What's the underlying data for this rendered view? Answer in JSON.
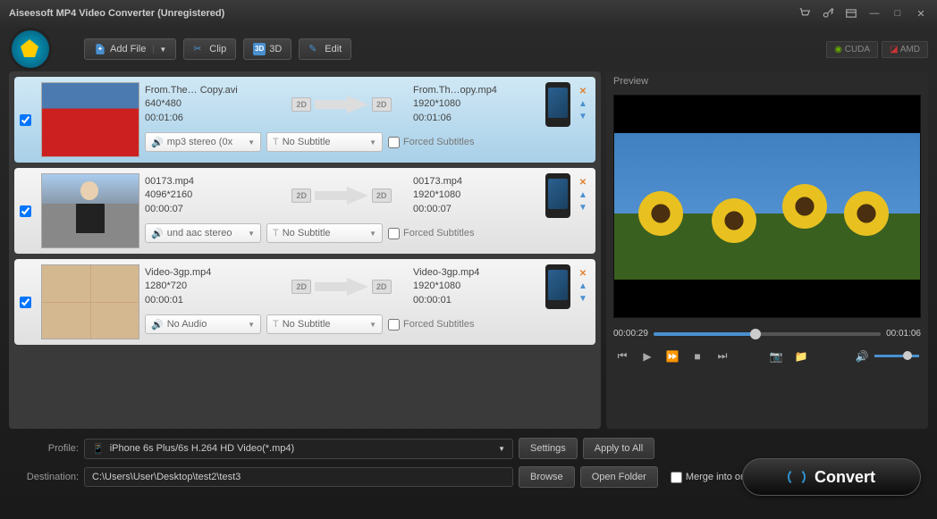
{
  "window": {
    "title": "Aiseesoft MP4 Video Converter (Unregistered)"
  },
  "toolbar": {
    "add_file": "Add File",
    "clip": "Clip",
    "three_d": "3D",
    "edit": "Edit",
    "cuda": "CUDA",
    "amd": "AMD"
  },
  "files": [
    {
      "selected": true,
      "src_name": "From.The… Copy.avi",
      "src_res": "640*480",
      "src_dur": "00:01:06",
      "dst_name": "From.Th…opy.mp4",
      "dst_res": "1920*1080",
      "dst_dur": "00:01:06",
      "audio": "mp3 stereo (0x",
      "subtitle": "No Subtitle",
      "forced": "Forced Subtitles"
    },
    {
      "selected": false,
      "src_name": "00173.mp4",
      "src_res": "4096*2160",
      "src_dur": "00:00:07",
      "dst_name": "00173.mp4",
      "dst_res": "1920*1080",
      "dst_dur": "00:00:07",
      "audio": "und aac stereo",
      "subtitle": "No Subtitle",
      "forced": "Forced Subtitles"
    },
    {
      "selected": false,
      "src_name": "Video-3gp.mp4",
      "src_res": "1280*720",
      "src_dur": "00:00:01",
      "dst_name": "Video-3gp.mp4",
      "dst_res": "1920*1080",
      "dst_dur": "00:00:01",
      "audio": "No Audio",
      "subtitle": "No Subtitle",
      "forced": "Forced Subtitles"
    }
  ],
  "preview": {
    "label": "Preview",
    "current_time": "00:00:29",
    "total_time": "00:01:06"
  },
  "bottom": {
    "profile_label": "Profile:",
    "profile_value": "iPhone 6s Plus/6s H.264 HD Video(*.mp4)",
    "settings": "Settings",
    "apply_all": "Apply to All",
    "destination_label": "Destination:",
    "destination_value": "C:\\Users\\User\\Desktop\\test2\\test3",
    "browse": "Browse",
    "open_folder": "Open Folder",
    "merge": "Merge into one file",
    "convert": "Convert"
  }
}
